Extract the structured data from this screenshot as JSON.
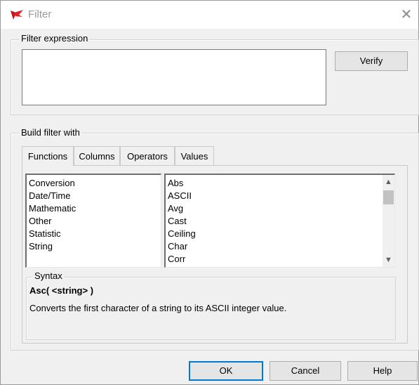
{
  "window": {
    "title": "Filter",
    "close_glyph": "✕",
    "app_icon": "app-logo-icon"
  },
  "filter_expression": {
    "label": "Filter expression",
    "value": "",
    "verify_label": "Verify"
  },
  "build": {
    "label": "Build filter with",
    "tabs": [
      {
        "label": "Functions",
        "active": true
      },
      {
        "label": "Columns",
        "active": false
      },
      {
        "label": "Operators",
        "active": false
      },
      {
        "label": "Values",
        "active": false
      }
    ],
    "categories": [
      "Conversion",
      "Date/Time",
      "Mathematic",
      "Other",
      "Statistic",
      "String"
    ],
    "functions": [
      "Abs",
      "ASCII",
      "Avg",
      "Cast",
      "Ceiling",
      "Char",
      "Corr"
    ],
    "syntax": {
      "label": "Syntax",
      "name": "Asc( <string> )",
      "description": "Converts the first character of a string to its ASCII integer value."
    }
  },
  "buttons": {
    "ok": "OK",
    "cancel": "Cancel",
    "help": "Help"
  },
  "icons": {
    "scroll_up": "▲",
    "scroll_down": "▼"
  }
}
